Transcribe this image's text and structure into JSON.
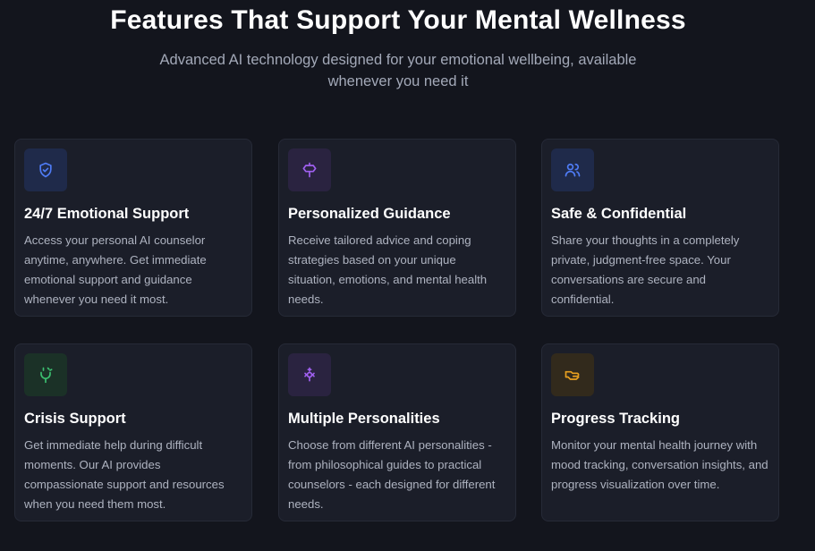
{
  "hero": {
    "title": "Features That Support Your Mental Wellness",
    "subtitle_line1": "Advanced AI technology designed for your emotional wellbeing, available",
    "subtitle_line2": "whenever you need it"
  },
  "features": [
    {
      "icon": "shield-check-icon",
      "icon_color": "#4f7cf6",
      "icon_bg": "#1f2a4a",
      "title": "24/7 Emotional Support",
      "description": "Access your personal AI counselor anytime, anywhere. Get immediate emotional support and guidance whenever you need it most."
    },
    {
      "icon": "signpost-icon",
      "icon_color": "#a060f0",
      "icon_bg": "#2a2340",
      "title": "Personalized Guidance",
      "description": "Receive tailored advice and coping strategies based on your unique situation, emotions, and mental health needs."
    },
    {
      "icon": "users-icon",
      "icon_color": "#4f7cf6",
      "icon_bg": "#1f2a4a",
      "title": "Safe & Confidential",
      "description": "Share your thoughts in a completely private, judgment-free space. Your conversations are secure and confidential."
    },
    {
      "icon": "plug-icon",
      "icon_color": "#3cc070",
      "icon_bg": "#1b3127",
      "title": "Crisis Support",
      "description": "Get immediate help during difficult moments. Our AI provides compassionate support and resources when you need them most."
    },
    {
      "icon": "personalities-icon",
      "icon_color": "#a060f0",
      "icon_bg": "#2a2340",
      "title": "Multiple Personalities",
      "description": "Choose from different AI personalities - from philosophical guides to practical counselors - each designed for different needs."
    },
    {
      "icon": "hand-icon",
      "icon_color": "#e8a020",
      "icon_bg": "#322a1c",
      "title": "Progress Tracking",
      "description": "Monitor your mental health journey with mood tracking, conversation insights, and progress visualization over time."
    }
  ]
}
